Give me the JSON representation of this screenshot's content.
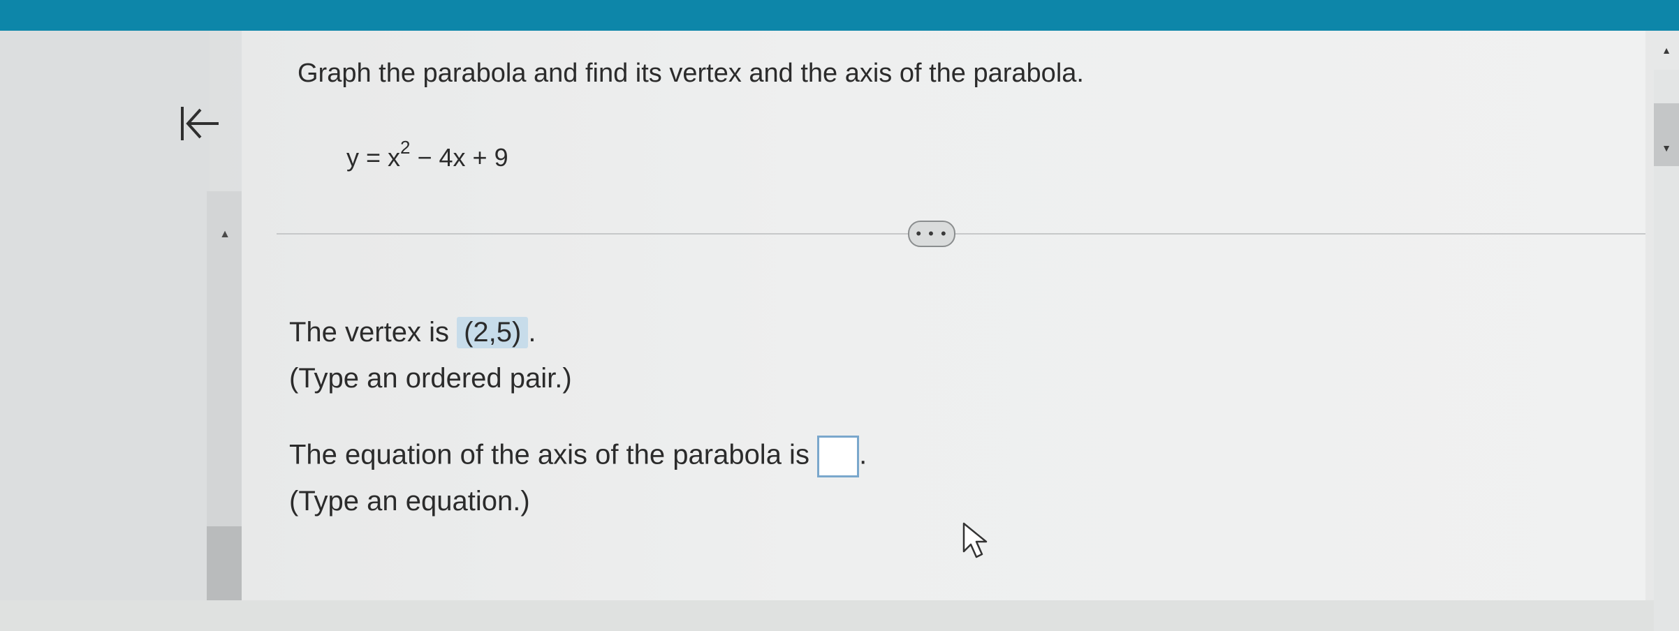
{
  "question": {
    "prompt": "Graph the parabola and find its vertex and the axis of the parabola.",
    "equation_lhs": "y = x",
    "equation_exponent": "2",
    "equation_rhs": " − 4x + 9"
  },
  "more_button": {
    "label": "• • •"
  },
  "vertex": {
    "label": "The vertex is",
    "value": "(2,5)",
    "suffix": ".",
    "hint": "(Type an ordered pair.)"
  },
  "axis": {
    "label": "The equation of the axis of the parabola is",
    "value": "",
    "suffix": ".",
    "hint": "(Type an equation.)"
  },
  "icons": {
    "back": "back-to-start-icon",
    "scroll_up": "scroll-up-arrow-icon",
    "scroll_down": "scroll-down-arrow-icon",
    "cursor": "mouse-pointer-icon"
  },
  "colors": {
    "topbar": "#0d86a9",
    "answer_highlight": "#c7dcea",
    "input_border": "#7aa7cc"
  }
}
